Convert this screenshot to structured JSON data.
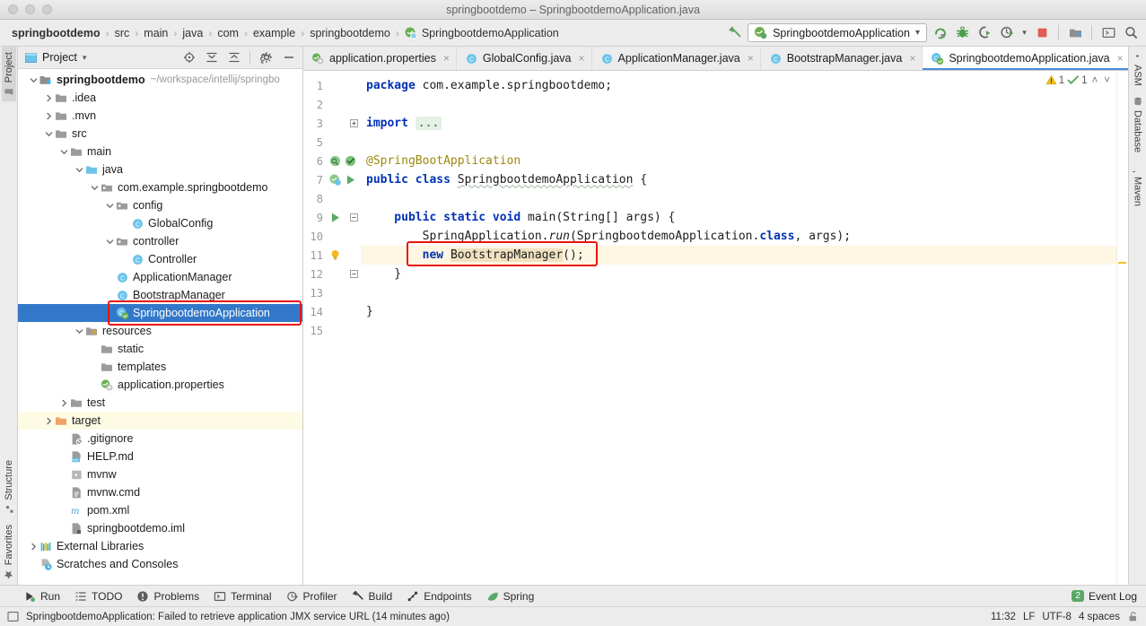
{
  "window": {
    "title": "springbootdemo – SpringbootdemoApplication.java"
  },
  "breadcrumb": {
    "items": [
      {
        "label": "springbootdemo",
        "icon": "none"
      },
      {
        "label": "src",
        "icon": "none"
      },
      {
        "label": "main",
        "icon": "none"
      },
      {
        "label": "java",
        "icon": "none"
      },
      {
        "label": "com",
        "icon": "none"
      },
      {
        "label": "example",
        "icon": "none"
      },
      {
        "label": "springbootdemo",
        "icon": "none"
      },
      {
        "label": "SpringbootdemoApplication",
        "icon": "spring-class-icon"
      }
    ],
    "separator": "›"
  },
  "toolbar": {
    "build_icon": "hammer-icon",
    "run_config": {
      "label": "SpringbootdemoApplication",
      "icon": "spring-run-icon",
      "chevron": "▾"
    },
    "buttons": [
      {
        "name": "run-button",
        "icon": "run-icon"
      },
      {
        "name": "debug-button",
        "icon": "bug-icon"
      },
      {
        "name": "run-with-coverage-button",
        "icon": "coverage-icon"
      },
      {
        "name": "profile-button",
        "icon": "profiler-icon"
      },
      {
        "name": "profile-dropdown",
        "icon": "chevron-down-icon"
      },
      {
        "name": "stop-button",
        "icon": "stop-icon"
      },
      {
        "name": "project-structure-button",
        "icon": "project-structure-icon"
      },
      {
        "name": "terminal-button",
        "icon": "terminal-icon"
      },
      {
        "name": "search-everywhere-button",
        "icon": "search-icon"
      }
    ]
  },
  "left_strip": {
    "top": [
      {
        "label": "Project",
        "icon": "project-icon",
        "active": true
      }
    ],
    "bottom": [
      {
        "label": "Structure",
        "icon": "structure-icon",
        "active": false
      },
      {
        "label": "Favorites",
        "icon": "star-icon",
        "active": false
      }
    ]
  },
  "right_strip": {
    "items": [
      {
        "label": "ASM",
        "icon": "asm-icon"
      },
      {
        "label": "Database",
        "icon": "database-icon"
      },
      {
        "label": "Maven",
        "icon": "maven-icon"
      }
    ]
  },
  "project_panel": {
    "title": "Project",
    "title_chevron": "▾",
    "header_buttons": [
      {
        "name": "select-opened-file-button",
        "icon": "locate-icon"
      },
      {
        "name": "expand-all-button",
        "icon": "expand-all-icon"
      },
      {
        "name": "collapse-all-button",
        "icon": "collapse-all-icon"
      },
      {
        "name": "settings-button",
        "icon": "gear-icon"
      },
      {
        "name": "hide-button",
        "icon": "minimize-icon"
      }
    ],
    "tree": [
      {
        "label": "springbootdemo",
        "path": "~/workspace/intellij/springbo",
        "indent": 0,
        "arrow": "down",
        "icon": "module-folder-icon",
        "bold": true,
        "state": "normal"
      },
      {
        "label": ".idea",
        "indent": 1,
        "arrow": "right",
        "icon": "folder-icon",
        "state": "normal"
      },
      {
        "label": ".mvn",
        "indent": 1,
        "arrow": "right",
        "icon": "folder-icon",
        "state": "normal"
      },
      {
        "label": "src",
        "indent": 1,
        "arrow": "down",
        "icon": "folder-icon",
        "state": "normal"
      },
      {
        "label": "main",
        "indent": 2,
        "arrow": "down",
        "icon": "folder-icon",
        "state": "normal"
      },
      {
        "label": "java",
        "indent": 3,
        "arrow": "down",
        "icon": "source-folder-icon",
        "state": "normal"
      },
      {
        "label": "com.example.springbootdemo",
        "indent": 4,
        "arrow": "down",
        "icon": "package-icon",
        "state": "normal"
      },
      {
        "label": "config",
        "indent": 5,
        "arrow": "down",
        "icon": "package-icon",
        "state": "normal"
      },
      {
        "label": "GlobalConfig",
        "indent": 6,
        "arrow": "none",
        "icon": "java-class-icon",
        "state": "normal"
      },
      {
        "label": "controller",
        "indent": 5,
        "arrow": "down",
        "icon": "package-icon",
        "state": "normal"
      },
      {
        "label": "Controller",
        "indent": 6,
        "arrow": "none",
        "icon": "java-class-icon",
        "state": "normal"
      },
      {
        "label": "ApplicationManager",
        "indent": 5,
        "arrow": "none",
        "icon": "java-class-icon",
        "state": "normal"
      },
      {
        "label": "BootstrapManager",
        "indent": 5,
        "arrow": "none",
        "icon": "java-class-icon",
        "state": "normal"
      },
      {
        "label": "SpringbootdemoApplication",
        "indent": 5,
        "arrow": "none",
        "icon": "spring-class-icon",
        "state": "selected"
      },
      {
        "label": "resources",
        "indent": 3,
        "arrow": "down",
        "icon": "resources-folder-icon",
        "state": "normal"
      },
      {
        "label": "static",
        "indent": 4,
        "arrow": "none",
        "icon": "folder-icon",
        "state": "normal"
      },
      {
        "label": "templates",
        "indent": 4,
        "arrow": "none",
        "icon": "folder-icon",
        "state": "normal"
      },
      {
        "label": "application.properties",
        "indent": 4,
        "arrow": "none",
        "icon": "spring-properties-icon",
        "state": "normal"
      },
      {
        "label": "test",
        "indent": 2,
        "arrow": "right",
        "icon": "folder-icon",
        "state": "normal"
      },
      {
        "label": "target",
        "indent": 1,
        "arrow": "right",
        "icon": "excluded-folder-icon",
        "state": "highlight"
      },
      {
        "label": ".gitignore",
        "indent": 2,
        "arrow": "none",
        "icon": "gitignore-file-icon",
        "state": "normal"
      },
      {
        "label": "HELP.md",
        "indent": 2,
        "arrow": "none",
        "icon": "markdown-file-icon",
        "state": "normal"
      },
      {
        "label": "mvnw",
        "indent": 2,
        "arrow": "none",
        "icon": "script-file-icon",
        "state": "normal"
      },
      {
        "label": "mvnw.cmd",
        "indent": 2,
        "arrow": "none",
        "icon": "text-file-icon",
        "state": "normal"
      },
      {
        "label": "pom.xml",
        "indent": 2,
        "arrow": "none",
        "icon": "maven-pom-icon",
        "state": "normal"
      },
      {
        "label": "springbootdemo.iml",
        "indent": 2,
        "arrow": "none",
        "icon": "iml-file-icon",
        "state": "normal"
      },
      {
        "label": "External Libraries",
        "indent": 0,
        "arrow": "right",
        "icon": "libraries-icon",
        "state": "normal"
      },
      {
        "label": "Scratches and Consoles",
        "indent": 0,
        "arrow": "none",
        "icon": "scratches-icon",
        "state": "normal"
      }
    ]
  },
  "editor_tabs": [
    {
      "label": "application.properties",
      "icon": "spring-properties-icon",
      "active": false,
      "close": "×"
    },
    {
      "label": "GlobalConfig.java",
      "icon": "java-class-icon",
      "active": false,
      "close": "×"
    },
    {
      "label": "ApplicationManager.java",
      "icon": "java-class-icon",
      "active": false,
      "close": "×"
    },
    {
      "label": "BootstrapManager.java",
      "icon": "java-class-icon",
      "active": false,
      "close": "×"
    },
    {
      "label": "SpringbootdemoApplication.java",
      "icon": "spring-class-icon",
      "active": true,
      "close": "×"
    }
  ],
  "editor": {
    "inspection": {
      "warning_count": "1",
      "ok_count": "1",
      "up_chevron": "˄",
      "down_chevron": "˅"
    },
    "lines": [
      {
        "num": "1",
        "tokens": [
          {
            "t": "package ",
            "c": "kw"
          },
          {
            "t": "com.example.springbootdemo;",
            "c": "pln"
          }
        ]
      },
      {
        "num": "2",
        "tokens": []
      },
      {
        "num": "3",
        "fold": "collapsed",
        "tokens": [
          {
            "t": "import ",
            "c": "kw"
          },
          {
            "t": "...",
            "c": "fold-ph"
          }
        ]
      },
      {
        "num": "5",
        "tokens": []
      },
      {
        "num": "6",
        "gutter_icons": [
          "spring-bean-icon",
          "spring-check-icon"
        ],
        "tokens": [
          {
            "t": "@SpringBootApplication",
            "c": "anno"
          }
        ]
      },
      {
        "num": "7",
        "gutter_icons": [
          "spring-run-icon",
          "run-gutter-icon"
        ],
        "tokens": [
          {
            "t": "public class ",
            "c": "kw"
          },
          {
            "t": "SpringbootdemoApplication",
            "c": "wavy"
          },
          {
            "t": " {",
            "c": "pln"
          }
        ]
      },
      {
        "num": "8",
        "tokens": []
      },
      {
        "num": "9",
        "gutter_icons": [
          "run-gutter-icon"
        ],
        "fold": "expanded",
        "tokens": [
          {
            "t": "    public static void ",
            "c": "kw"
          },
          {
            "t": "main",
            "c": "method"
          },
          {
            "t": "(String[] args) {",
            "c": "pln"
          }
        ]
      },
      {
        "num": "10",
        "tokens": [
          {
            "t": "        SpringApplication.",
            "c": "pln"
          },
          {
            "t": "run",
            "c": "ital"
          },
          {
            "t": "(SpringbootdemoApplication.",
            "c": "pln"
          },
          {
            "t": "class",
            "c": "kw"
          },
          {
            "t": ", args);",
            "c": "pln"
          }
        ]
      },
      {
        "num": "11",
        "highlight": true,
        "gutter_icons": [
          "lightbulb-icon"
        ],
        "annotated": true,
        "tokens": [
          {
            "t": "        ",
            "c": "pln"
          },
          {
            "t": "new ",
            "c": "kw"
          },
          {
            "t": "BootstrapManager",
            "c": "ident-hl"
          },
          {
            "t": "();",
            "c": "pln"
          }
        ]
      },
      {
        "num": "12",
        "fold": "expanded",
        "tokens": [
          {
            "t": "    }",
            "c": "pln"
          }
        ]
      },
      {
        "num": "13",
        "tokens": []
      },
      {
        "num": "14",
        "tokens": [
          {
            "t": "}",
            "c": "pln"
          }
        ]
      },
      {
        "num": "15",
        "tokens": []
      }
    ]
  },
  "bottom_bar": {
    "items": [
      {
        "label": "Run",
        "icon": "run-icon"
      },
      {
        "label": "TODO",
        "icon": "todo-icon"
      },
      {
        "label": "Problems",
        "icon": "problems-icon"
      },
      {
        "label": "Terminal",
        "icon": "terminal-icon"
      },
      {
        "label": "Profiler",
        "icon": "profiler-icon"
      },
      {
        "label": "Build",
        "icon": "hammer-icon"
      },
      {
        "label": "Endpoints",
        "icon": "endpoints-icon"
      },
      {
        "label": "Spring",
        "icon": "spring-leaf-icon"
      }
    ],
    "event_log": {
      "label": "Event Log",
      "count": "2"
    }
  },
  "status_bar": {
    "message": "SpringbootdemoApplication: Failed to retrieve application JMX service URL (14 minutes ago)",
    "message_icon": "console-icon",
    "time": "11:32",
    "line_separator": "LF",
    "encoding": "UTF-8",
    "indent": "4 spaces",
    "lock_icon": "unlocked-icon"
  },
  "colors": {
    "selection_blue": "#3378c8",
    "annotation_red": "#e8140d",
    "highlight_yellow": "#fdfbe4",
    "badge_green": "#59a869",
    "keyword_blue": "#0033b3",
    "annotation_gold": "#9e880d"
  }
}
